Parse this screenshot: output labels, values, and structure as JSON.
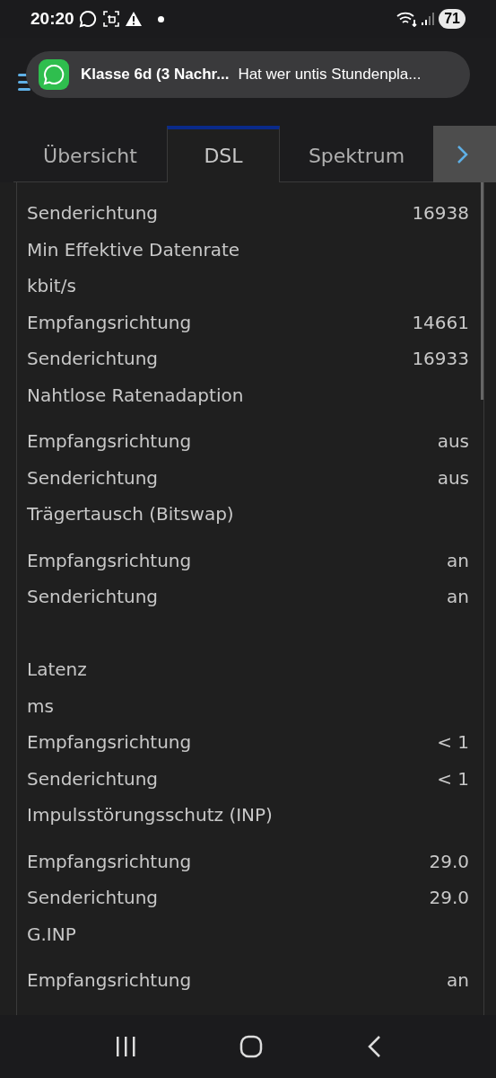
{
  "status_bar": {
    "time": "20:20",
    "battery": "71"
  },
  "notification": {
    "title": "Klasse 6d (3 Nachr...",
    "message": "Hat wer untis Stundenpla..."
  },
  "tabs": [
    {
      "label": "Übersicht",
      "selected": false
    },
    {
      "label": "DSL",
      "selected": true
    },
    {
      "label": "Spektrum",
      "selected": false
    }
  ],
  "rows": [
    {
      "kind": "value",
      "label": "Senderichtung",
      "value": "16938"
    },
    {
      "kind": "title",
      "label": "Min Effektive Datenrate"
    },
    {
      "kind": "title",
      "label": "kbit/s"
    },
    {
      "kind": "value",
      "label": "Empfangsrichtung",
      "value": "14661"
    },
    {
      "kind": "value",
      "label": "Senderichtung",
      "value": "16933"
    },
    {
      "kind": "group-title",
      "label": "Nahtlose Ratenadaption"
    },
    {
      "kind": "value",
      "label": "Empfangsrichtung",
      "value": "aus"
    },
    {
      "kind": "value",
      "label": "Senderichtung",
      "value": "aus"
    },
    {
      "kind": "group-title",
      "label": "Trägertausch (Bitswap)"
    },
    {
      "kind": "value",
      "label": "Empfangsrichtung",
      "value": "an"
    },
    {
      "kind": "value",
      "label": "Senderichtung",
      "value": "an"
    },
    {
      "kind": "spacer"
    },
    {
      "kind": "title",
      "label": "Latenz"
    },
    {
      "kind": "title",
      "label": "ms"
    },
    {
      "kind": "value",
      "label": "Empfangsrichtung",
      "value": "< 1"
    },
    {
      "kind": "value",
      "label": "Senderichtung",
      "value": "< 1"
    },
    {
      "kind": "group-title",
      "label": "Impulsstörungsschutz (INP)"
    },
    {
      "kind": "value",
      "label": "Empfangsrichtung",
      "value": "29.0"
    },
    {
      "kind": "value",
      "label": "Senderichtung",
      "value": "29.0"
    },
    {
      "kind": "group-title",
      "label": "G.INP"
    },
    {
      "kind": "value",
      "label": "Empfangsrichtung",
      "value": "an"
    }
  ]
}
